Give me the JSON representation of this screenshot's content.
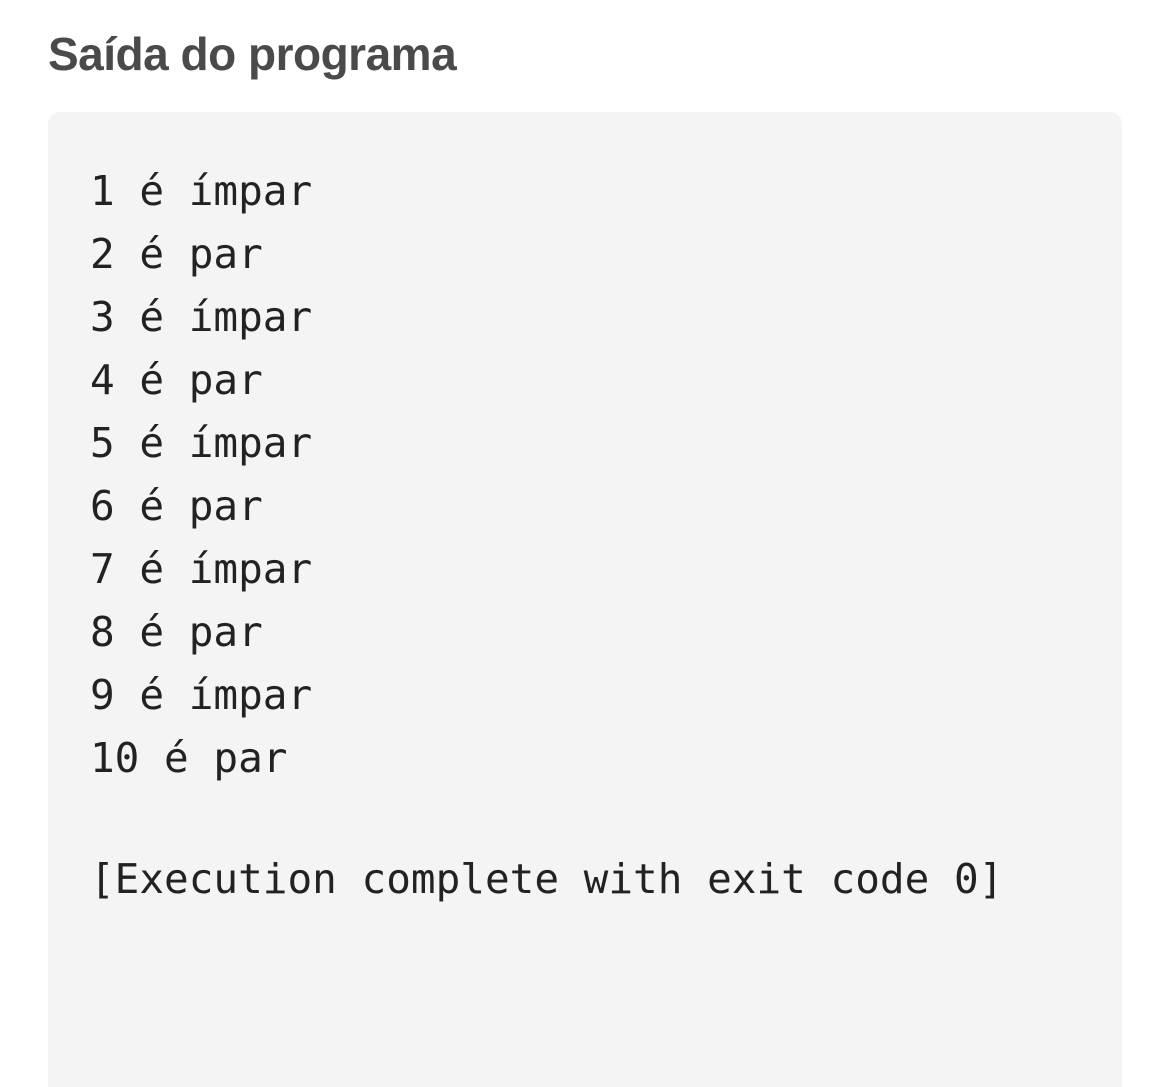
{
  "section": {
    "title": "Saída do programa"
  },
  "output": {
    "lines": [
      "1 é ímpar",
      "2 é par",
      "3 é ímpar",
      "4 é par",
      "5 é ímpar",
      "6 é par",
      "7 é ímpar",
      "8 é par",
      "9 é ímpar",
      "10 é par"
    ],
    "status": "[Execution complete with exit code 0]"
  },
  "colors": {
    "title": "#4a4a4a",
    "panel_background": "#f4f4f4",
    "text": "#222222"
  }
}
